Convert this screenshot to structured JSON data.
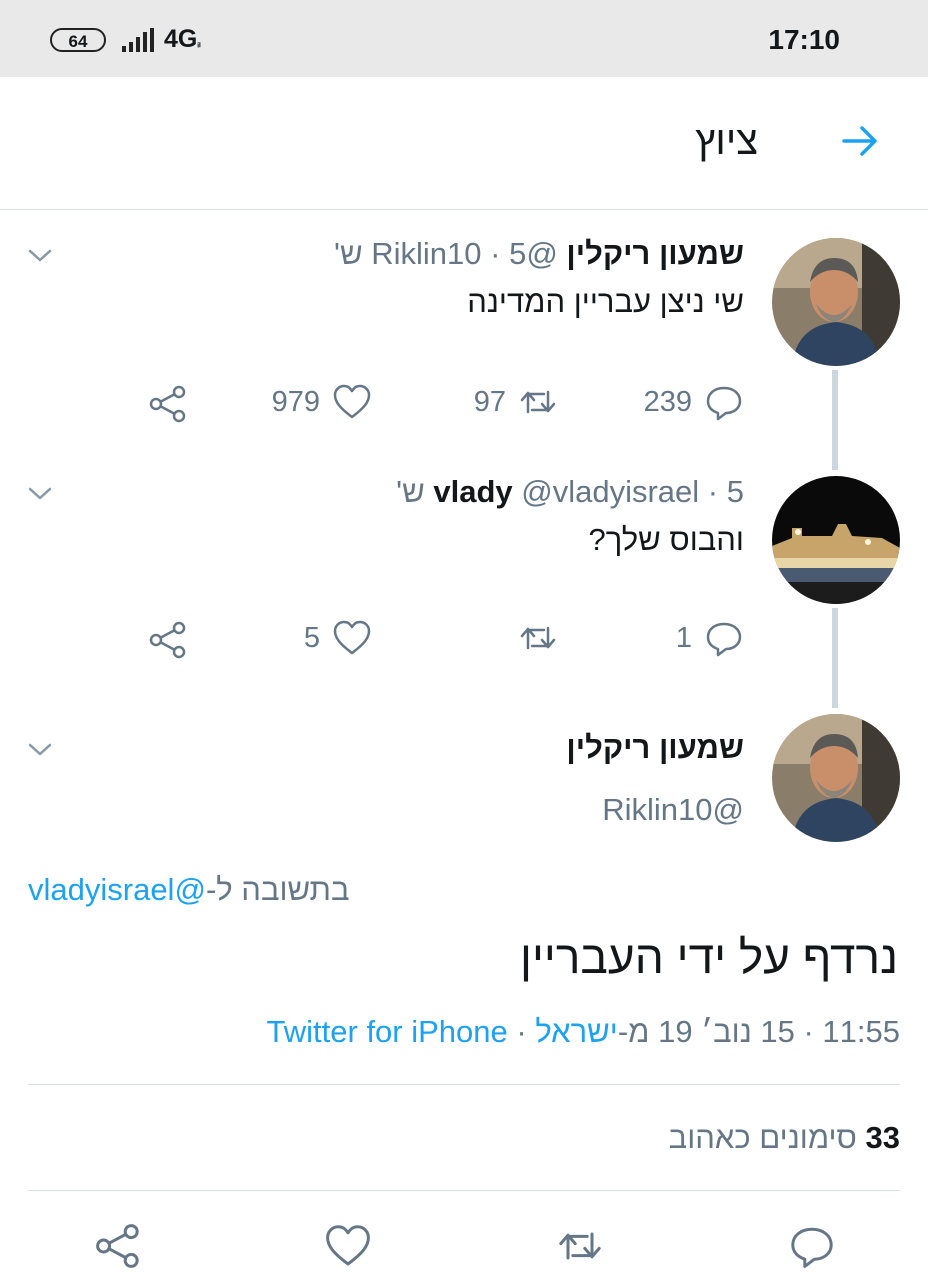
{
  "status_bar": {
    "battery": "64",
    "network": "4G",
    "network_sub": "ᵢₗ",
    "time": "17:10"
  },
  "header": {
    "title": "ציוץ",
    "back_icon": "arrow-right-icon",
    "accent": "#1da1f2"
  },
  "tweets": [
    {
      "name": "שמעון ריקלין",
      "handle": "@Riklin10",
      "time": "5 ש'",
      "text": "שי ניצן עבריין המדינה",
      "replies": "239",
      "retweets": "97",
      "likes": "979"
    },
    {
      "name": "vlady",
      "handle": "@vladyisrael",
      "time": "5 ש'",
      "text": "והבוס שלך?",
      "replies": "1",
      "retweets": "",
      "likes": "5"
    }
  ],
  "main_tweet": {
    "name": "שמעון ריקלין",
    "handle": "@Riklin10",
    "reply_prefix": "בתשובה ל-",
    "reply_handle": "@vladyisrael",
    "text": "נרדף על ידי העבריין",
    "time_date": "11:55 · 15 נוב׳ 19 מ-",
    "location": "ישראל",
    "separator": " · ",
    "client": "Twitter for iPhone",
    "likes_count": "33",
    "likes_label": "סימונים כאהוב"
  }
}
